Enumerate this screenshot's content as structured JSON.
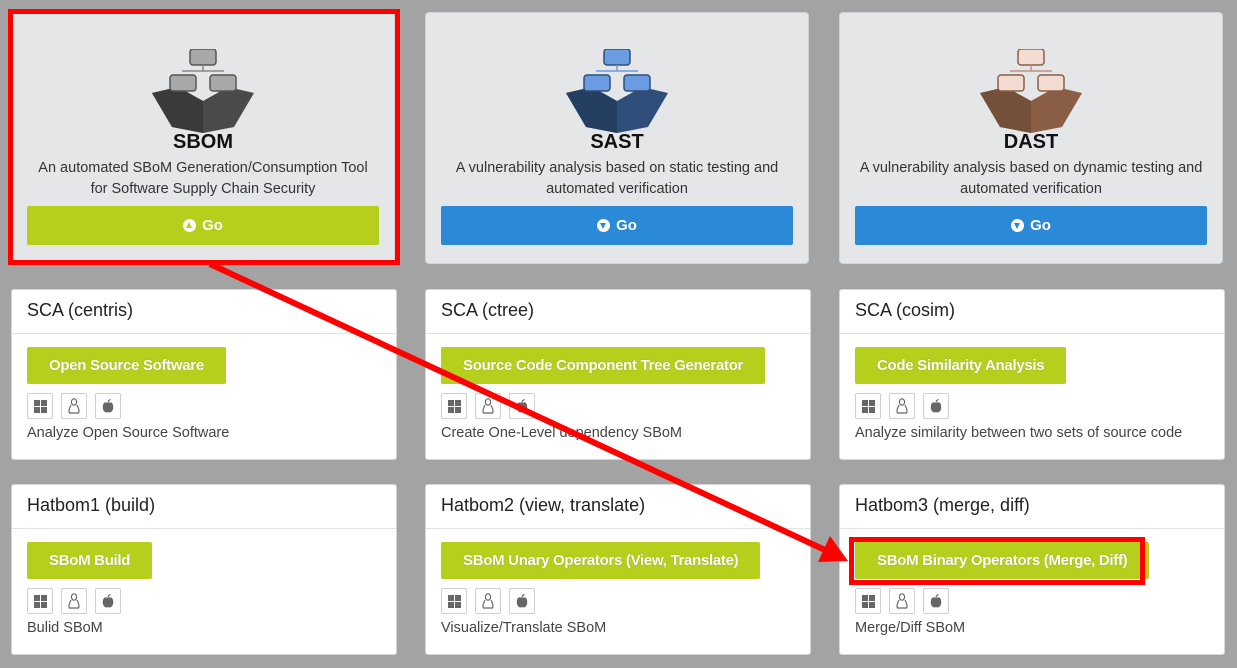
{
  "features": [
    {
      "title": "SBOM",
      "desc": "An automated SBoM Generation/Consumption Tool for Software Supply Chain Security",
      "go": "Go",
      "color": "#b5cf1c",
      "icon": "circle-arrow-up-icon"
    },
    {
      "title": "SAST",
      "desc": "A vulnerability analysis based on static testing and automated verification",
      "go": "Go",
      "color": "#2a8ad8",
      "icon": "circle-arrow-down-icon"
    },
    {
      "title": "DAST",
      "desc": "A vulnerability analysis based on dynamic testing and automated verification",
      "go": "Go",
      "color": "#2a8ad8",
      "icon": "circle-arrow-down-icon"
    }
  ],
  "cards": [
    {
      "title": "SCA (centris)",
      "button": "Open Source Software",
      "desc": "Analyze Open Source Software"
    },
    {
      "title": "SCA (ctree)",
      "button": "Source Code Component Tree Generator",
      "desc": "Create One-Level dependency SBoM"
    },
    {
      "title": "SCA (cosim)",
      "button": "Code Similarity Analysis",
      "desc": "Analyze similarity between two sets of source code"
    },
    {
      "title": "Hatbom1 (build)",
      "button": "SBoM Build",
      "desc": "Bulid SBoM"
    },
    {
      "title": "Hatbom2 (view, translate)",
      "button": "SBoM Unary Operators (View, Translate)",
      "desc": "Visualize/Translate SBoM"
    },
    {
      "title": "Hatbom3 (merge, diff)",
      "button": "SBoM Binary Operators (Merge, Diff)",
      "desc": "Merge/Diff SBoM"
    }
  ],
  "os_icons": [
    "windows-icon",
    "linux-icon",
    "apple-icon"
  ],
  "annotation_color": "#ff0000"
}
